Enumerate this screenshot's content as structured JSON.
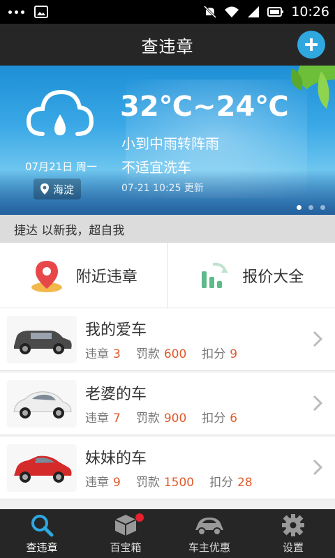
{
  "statusbar": {
    "time": "10:26"
  },
  "header": {
    "title": "查违章"
  },
  "weather": {
    "temperature": "32℃~24℃",
    "condition": "小到中雨转阵雨",
    "wash_advice": "不适宜洗车",
    "updated": "07-21 10:25 更新",
    "date": "07月21日 周一",
    "location": "海淀"
  },
  "slogan": "捷达 以新我，超自我",
  "actions": [
    {
      "label": "附近违章"
    },
    {
      "label": "报价大全"
    }
  ],
  "labels": {
    "violations": "违章",
    "fine": "罚款",
    "points": "扣分"
  },
  "cars": [
    {
      "name": "我的爱车",
      "violations": "3",
      "fine": "600",
      "points": "9"
    },
    {
      "name": "老婆的车",
      "violations": "7",
      "fine": "900",
      "points": "6"
    },
    {
      "name": "妹妹的车",
      "violations": "9",
      "fine": "1500",
      "points": "28"
    }
  ],
  "nav": [
    {
      "label": "查违章",
      "icon": "search-icon"
    },
    {
      "label": "百宝箱",
      "icon": "box-icon"
    },
    {
      "label": "车主优惠",
      "icon": "car-icon"
    },
    {
      "label": "设置",
      "icon": "gear-icon"
    }
  ],
  "colors": {
    "accent": "#2fa8e0",
    "value": "#e05a2b",
    "bar": "#262626",
    "badge": "#e81f2c"
  }
}
